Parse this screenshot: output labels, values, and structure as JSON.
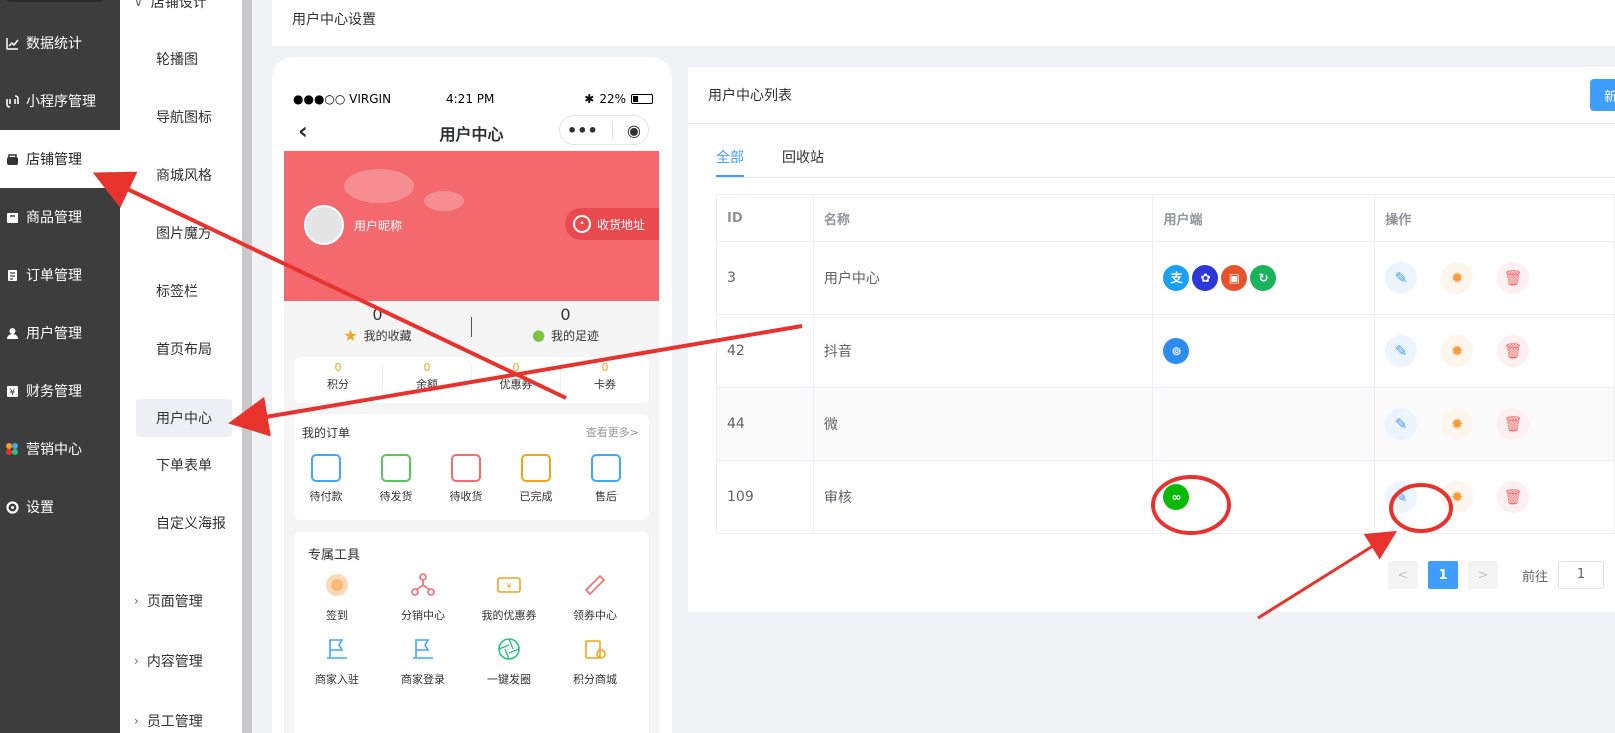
{
  "sidebar": {
    "items": [
      {
        "label": "数据统计",
        "icon": "chart-line-icon"
      },
      {
        "label": "小程序管理",
        "icon": "link-icon"
      },
      {
        "label": "店铺管理",
        "icon": "shop-icon"
      },
      {
        "label": "商品管理",
        "icon": "goods-icon"
      },
      {
        "label": "订单管理",
        "icon": "order-icon"
      },
      {
        "label": "用户管理",
        "icon": "user-icon"
      },
      {
        "label": "财务管理",
        "icon": "finance-icon"
      },
      {
        "label": "营销中心",
        "icon": "marketing-icon"
      },
      {
        "label": "设置",
        "icon": "settings-icon"
      }
    ],
    "active": "店铺管理"
  },
  "subnav": {
    "group_top": "店铺设计",
    "items": [
      "轮播图",
      "导航图标",
      "商城风格",
      "图片魔方",
      "标签栏",
      "首页布局",
      "用户中心",
      "下单表单",
      "自定义海报"
    ],
    "active": "用户中心",
    "groups": [
      "页面管理",
      "内容管理",
      "员工管理"
    ]
  },
  "header": {
    "title": "用户中心设置"
  },
  "phone": {
    "carrier": "●●●○○ VIRGIN",
    "time": "4:21 PM",
    "battery": "22%",
    "title": "用户中心",
    "nickname": "用户昵称",
    "address_btn": "收货地址",
    "stats": [
      {
        "num": "0",
        "label": "我的收藏"
      },
      {
        "num": "0",
        "label": "我的足迹"
      }
    ],
    "assets": [
      {
        "num": "0",
        "label": "积分"
      },
      {
        "num": "0",
        "label": "余额"
      },
      {
        "num": "0",
        "label": "优惠券"
      },
      {
        "num": "0",
        "label": "卡券"
      }
    ],
    "orders": {
      "title": "我的订单",
      "more": "查看更多>",
      "items": [
        "待付款",
        "待发货",
        "待收货",
        "已完成",
        "售后"
      ]
    },
    "tools": {
      "title": "专属工具",
      "items": [
        "签到",
        "分销中心",
        "我的优惠券",
        "领券中心",
        "商家入驻",
        "商家登录",
        "一键发圈",
        "积分商城"
      ]
    }
  },
  "panel": {
    "title": "用户中心列表",
    "new_btn": "新",
    "tabs": [
      "全部",
      "回收站"
    ],
    "columns": [
      "ID",
      "名称",
      "用户端",
      "操作"
    ],
    "rows": [
      {
        "id": "3",
        "name": "用户中心",
        "clients": [
          "alipay",
          "baidu",
          "toutiao",
          "wechat"
        ]
      },
      {
        "id": "42",
        "name": "抖音",
        "clients": [
          "douyin"
        ]
      },
      {
        "id": "44",
        "name": "微",
        "clients": []
      },
      {
        "id": "109",
        "name": "审核",
        "clients": [
          "miniprogram"
        ]
      }
    ],
    "pager": {
      "current": "1",
      "goto_label": "前往",
      "goto_value": "1",
      "prev": "<",
      "next": ">"
    }
  },
  "colors": {
    "accent": "#409eff",
    "banner": "#f3696d",
    "annotation": "#e8322e",
    "sidebar": "#3d3d3d"
  }
}
